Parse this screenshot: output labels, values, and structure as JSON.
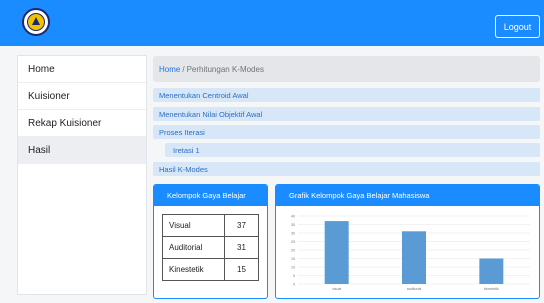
{
  "header": {
    "logout_label": "Logout"
  },
  "sidebar": {
    "items": [
      {
        "label": "Home"
      },
      {
        "label": "Kuisioner"
      },
      {
        "label": "Rekap Kuisioner"
      },
      {
        "label": "Hasil"
      }
    ]
  },
  "breadcrumb": {
    "home": "Home",
    "separator": "/",
    "current": "Perhitungan K-Modes"
  },
  "sections": {
    "centroid": "Menentukan Centroid Awal",
    "objektif": "Menentukan Nilai Objektif Awal",
    "iterasi": "Proses Iterasi",
    "iterasi_1": "Iretasi 1",
    "hasil": "Hasil K-Modes"
  },
  "kelompok": {
    "title": "Kelompok Gaya Belajar",
    "rows": [
      {
        "label": "Visual",
        "value": "37"
      },
      {
        "label": "Auditorial",
        "value": "31"
      },
      {
        "label": "Kinestetik",
        "value": "15"
      }
    ]
  },
  "grafik": {
    "title": "Grafik Kelompok Gaya Belajar Mahasiswa"
  },
  "colors": {
    "primary": "#1a8cff",
    "bar": "#5b9bd5",
    "accordion": "#d7e7f8"
  },
  "chart_data": {
    "type": "bar",
    "title": "",
    "categories": [
      "visual",
      "auditorial",
      "kinestetik"
    ],
    "values": [
      37,
      31,
      15
    ],
    "ylim": [
      0,
      40
    ],
    "yticks": [
      0,
      5,
      10,
      15,
      20,
      25,
      30,
      35,
      40
    ],
    "grid": true,
    "legend": "none"
  }
}
